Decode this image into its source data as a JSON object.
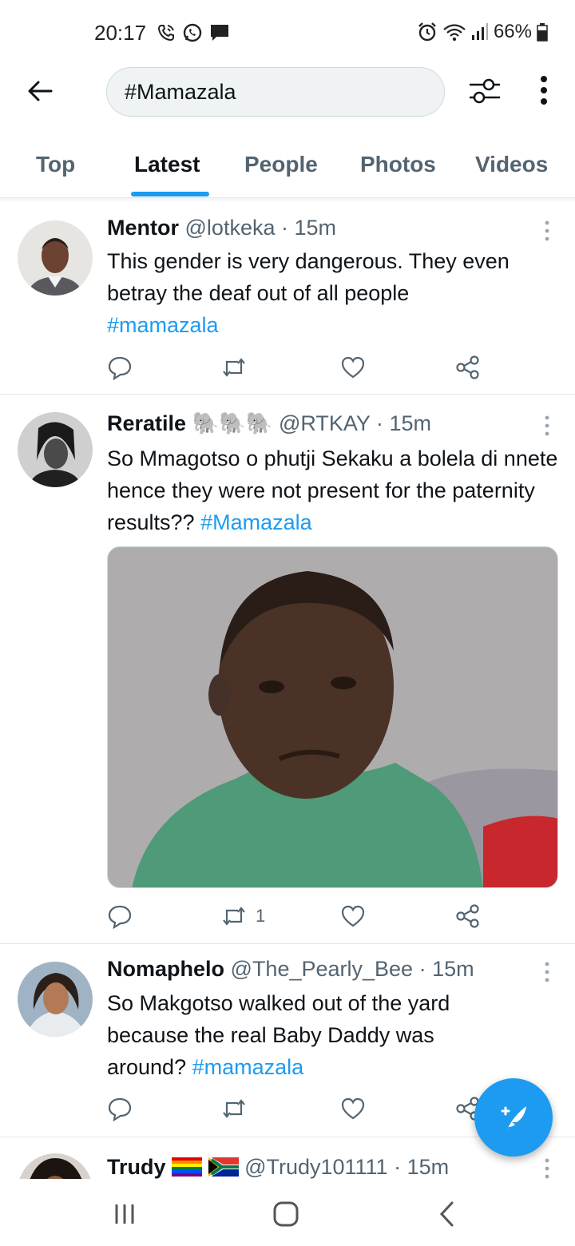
{
  "status_bar": {
    "time": "20:17",
    "battery": "66%",
    "icons_left": [
      "wifi-call-icon",
      "whatsapp-icon",
      "message-icon"
    ],
    "icons_right": [
      "alarm-icon",
      "wifi-icon",
      "signal-icon",
      "battery-icon"
    ]
  },
  "header": {
    "search_value": "#Mamazala"
  },
  "tabs": [
    {
      "label": "Top",
      "active": false
    },
    {
      "label": "Latest",
      "active": true
    },
    {
      "label": "People",
      "active": false
    },
    {
      "label": "Photos",
      "active": false
    },
    {
      "label": "Videos",
      "active": false
    }
  ],
  "tweets": [
    {
      "name": "Mentor",
      "handle": "@lotkeka",
      "time": "15m",
      "text": "This gender is very dangerous. They even betray the deaf out of all people",
      "hashtag": "#mamazala",
      "retweets": "",
      "has_media": false
    },
    {
      "name": "Reratile",
      "name_emoji": "🐘🐘🐘",
      "handle": "@RTKAY",
      "time": "15m",
      "text": "So Mmagotso o phutji Sekaku a bolela di nnete hence they were not present for the paternity results??",
      "hashtag": "#Mamazala",
      "retweets": "1",
      "has_media": true
    },
    {
      "name": "Nomaphelo",
      "handle": "@The_Pearly_Bee",
      "time": "15m",
      "text": "So Makgotso walked out of the yard because the real Baby Daddy was around?",
      "hashtag": "#mamazala",
      "retweets": "",
      "has_media": false
    },
    {
      "name": "Trudy",
      "handle": "@Trudy101111",
      "time": "15m",
      "flags": [
        "rainbow-flag",
        "south-africa-flag"
      ]
    }
  ],
  "separator": "·",
  "colors": {
    "accent": "#1d9bf0",
    "text_primary": "#0f1419",
    "text_secondary": "#536471",
    "border": "#e1e8ed"
  },
  "fab": {
    "icon": "compose-tweet-icon"
  },
  "nav_bar": {
    "icons": [
      "recent-apps-icon",
      "home-icon",
      "back-icon"
    ]
  }
}
